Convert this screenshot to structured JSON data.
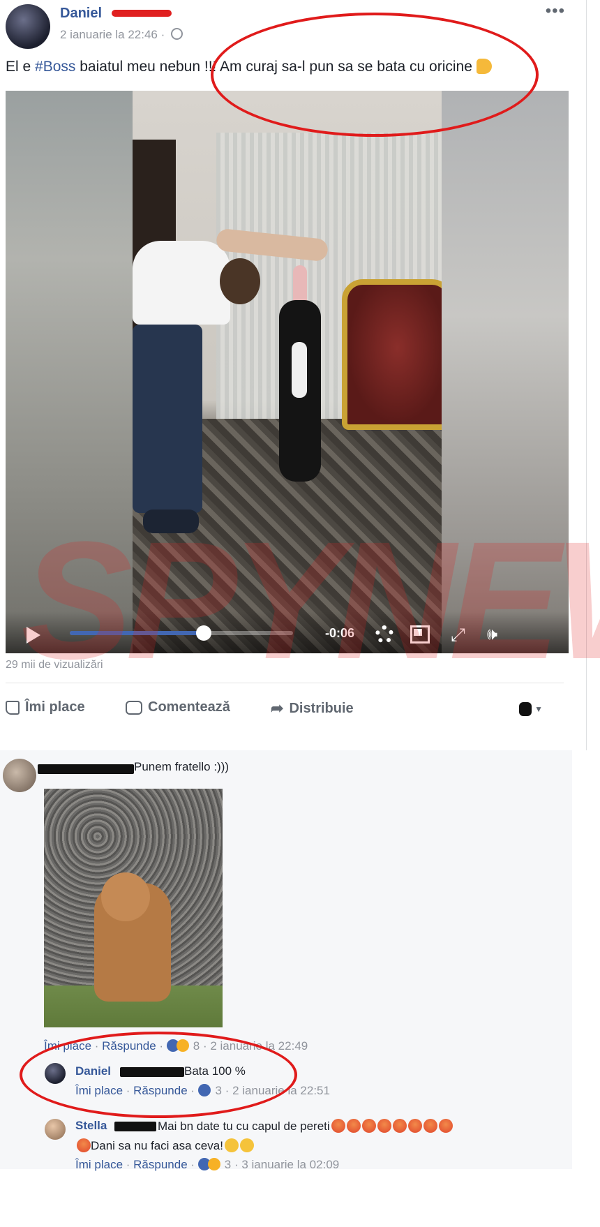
{
  "post": {
    "author": "Daniel",
    "date": "2 ianuarie la 22:46 ·",
    "more": "•••",
    "text_before": "El e ",
    "hashtag": "#Boss",
    "text_after": " baiatul meu nebun !!! Am curaj sa-l pun sa se bata cu oricine",
    "video": {
      "time_remaining": "-0:06",
      "progress_fraction": 0.6,
      "watermark": "SPYNEWS"
    },
    "views": "29 mii de vizualizări",
    "actions": {
      "like": "Îmi place",
      "comment": "Comentează",
      "share": "Distribuie"
    }
  },
  "comments": [
    {
      "text": "Punem fratello :)))",
      "like": "Îmi place",
      "reply": "Răspunde",
      "reactions": "8",
      "date": "2 ianuarie la 22:49"
    },
    {
      "name": "Daniel",
      "text": "Bata 100 %",
      "like": "Îmi place",
      "reply": "Răspunde",
      "reactions": "3",
      "date": "2 ianuarie la 22:51"
    },
    {
      "name": "Stella",
      "text1": "Mai bn date tu cu capul de pereti",
      "text2": "Dani sa nu faci asa ceva!",
      "like": "Îmi place",
      "reply": "Răspunde",
      "reactions": "3",
      "date": "3 ianuarie la 02:09"
    }
  ],
  "colors": {
    "link": "#365899",
    "annotation": "#e01b1b",
    "progress": "#4267b2"
  }
}
